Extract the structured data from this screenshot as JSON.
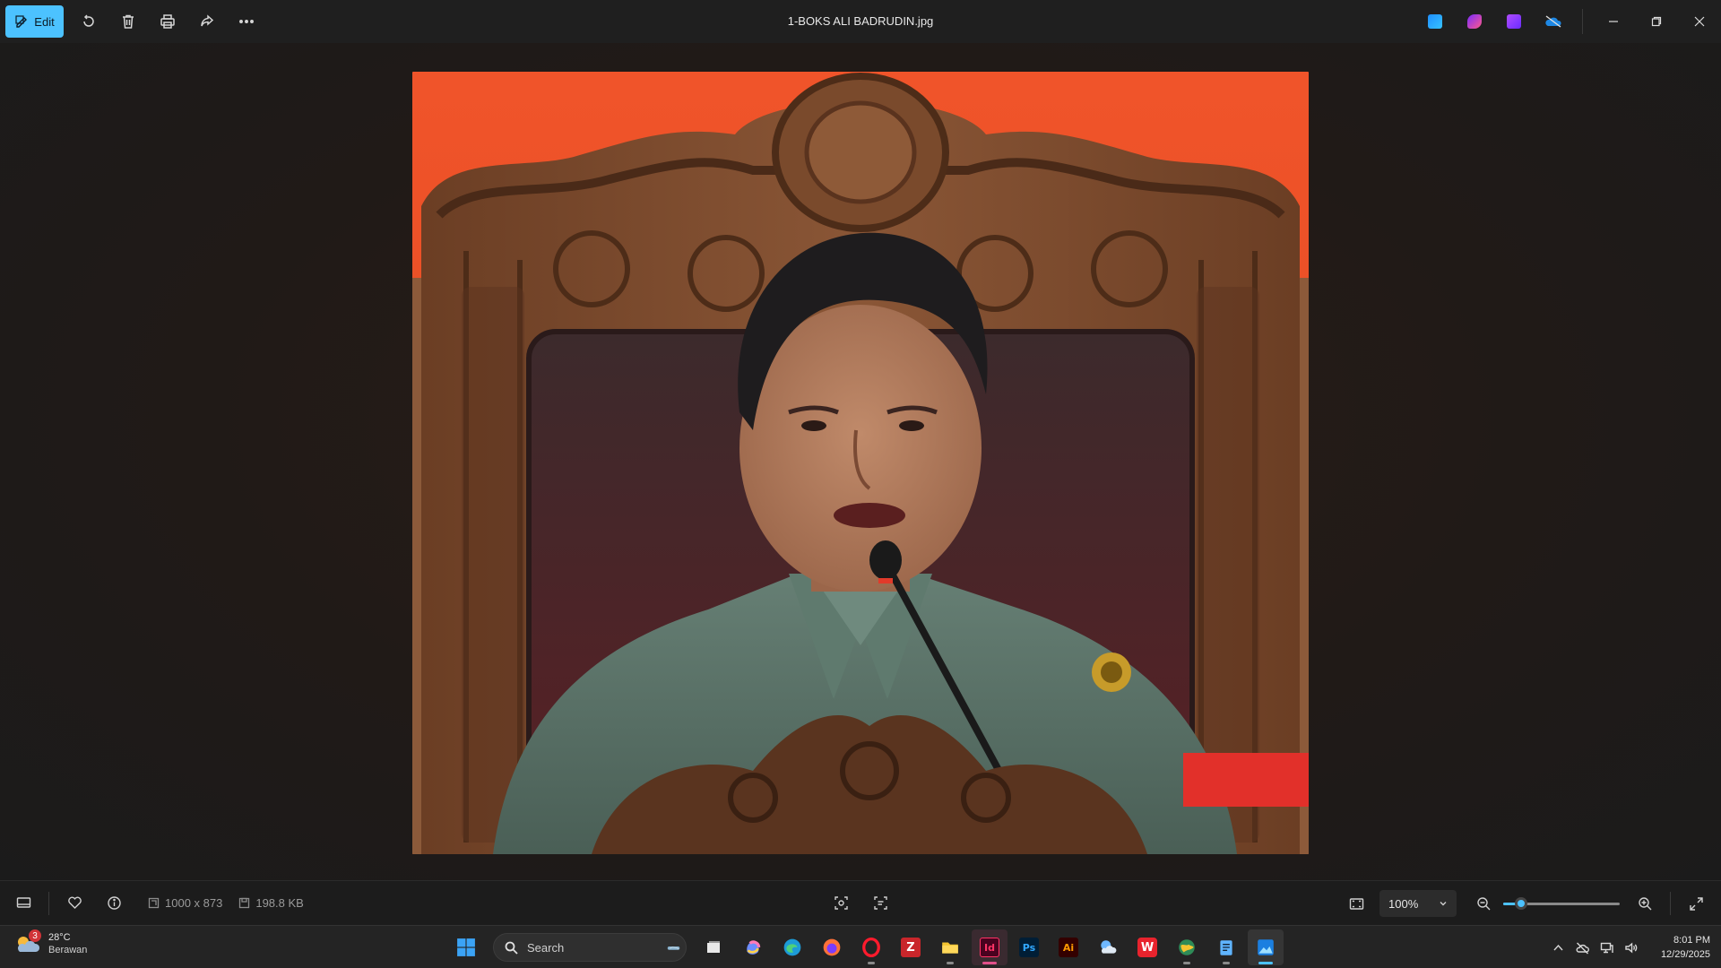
{
  "toolbar": {
    "edit_label": "Edit",
    "file_name": "1-BOKS ALI BADRUDIN.jpg",
    "icons": [
      "rotate-icon",
      "delete-icon",
      "print-icon",
      "share-icon",
      "more-icon"
    ]
  },
  "status": {
    "dimensions": "1000 x 873",
    "file_size": "198.8 KB",
    "zoom_level": "100%",
    "zoom_slider_fraction": 0.15
  },
  "taskbar": {
    "weather_temp": "28°C",
    "weather_desc": "Berawan",
    "weather_badge": "3",
    "search_placeholder": "Search",
    "time": "8:01 PM",
    "date": "12/29/2025",
    "apps": [
      {
        "name": "windows-start",
        "glyph": ""
      },
      {
        "name": "task-view",
        "glyph": ""
      },
      {
        "name": "copilot",
        "glyph": ""
      },
      {
        "name": "edge",
        "glyph": ""
      },
      {
        "name": "firefox",
        "glyph": ""
      },
      {
        "name": "opera",
        "glyph": "O"
      },
      {
        "name": "filezilla",
        "glyph": "Z"
      },
      {
        "name": "file-explorer",
        "glyph": ""
      },
      {
        "name": "indesign",
        "glyph": "Id"
      },
      {
        "name": "photoshop",
        "glyph": "Ps"
      },
      {
        "name": "illustrator",
        "glyph": "Ai"
      },
      {
        "name": "weather-app",
        "glyph": ""
      },
      {
        "name": "wps",
        "glyph": "W"
      },
      {
        "name": "maps",
        "glyph": ""
      },
      {
        "name": "notepad",
        "glyph": ""
      },
      {
        "name": "photos",
        "glyph": ""
      }
    ]
  },
  "colors": {
    "accent": "#4cc2ff",
    "backdrop_red": "#f05a28",
    "wood": "#7a4a2e",
    "leather": "#3a2528",
    "suit": "#5b7469"
  }
}
